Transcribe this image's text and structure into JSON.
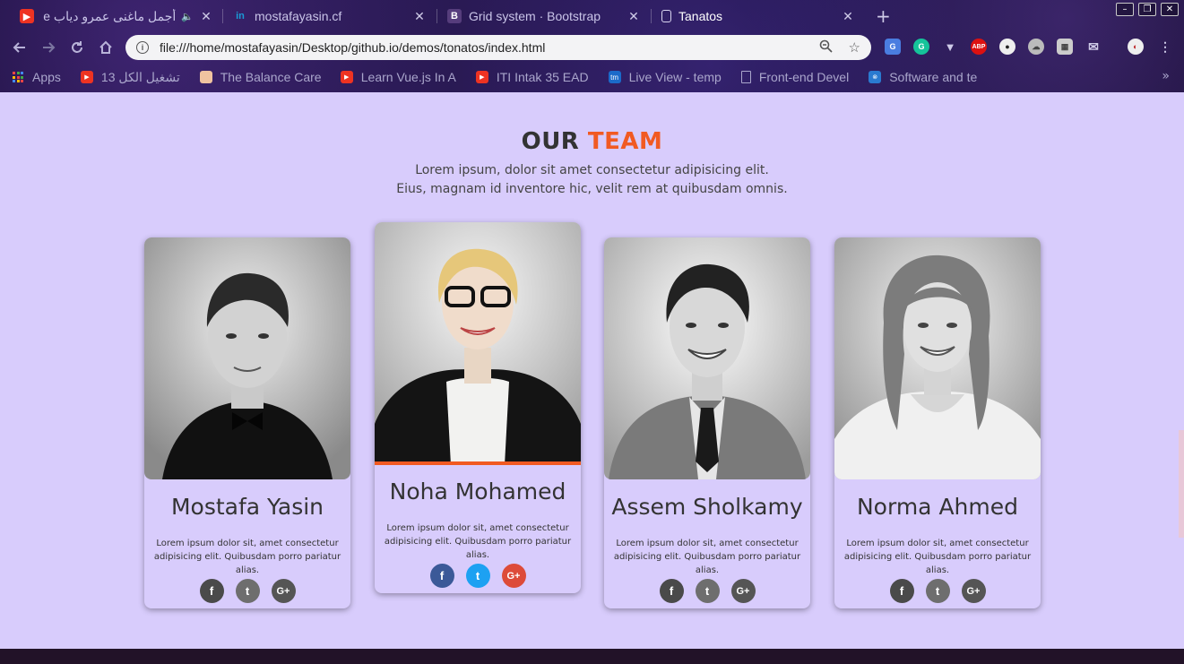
{
  "browser": {
    "tabs": [
      {
        "title": "أجمل ماغنى عمرو دياب e",
        "icon": "youtube-icon",
        "active": false,
        "audio": true
      },
      {
        "title": "mostafayasin.cf",
        "icon": "site-icon",
        "active": false
      },
      {
        "title": "Grid system · Bootstrap",
        "icon": "bootstrap-icon",
        "active": false
      },
      {
        "title": "Tanatos",
        "icon": "document-icon",
        "active": true
      }
    ],
    "new_tab_symbol": "+",
    "window_controls": {
      "minimize": "–",
      "restore": "❐",
      "close": "✕"
    },
    "url": "file:///home/mostafayasin/Desktop/github.io/demos/tonatos/index.html",
    "info_symbol": "i",
    "extensions": [
      "translate-icon",
      "grammarly-icon",
      "vue-devtools-icon",
      "adblock-icon",
      "extension-icon",
      "cloud-icon",
      "photo-icon",
      "mail-icon",
      "profile-icon"
    ],
    "adblock_label": "ABP",
    "bookmarks": [
      {
        "label": "Apps",
        "icon": "apps-grid-icon"
      },
      {
        "label": "13 تشغيل الكل",
        "icon": "youtube-icon"
      },
      {
        "label": "The Balance Care",
        "icon": "site-icon"
      },
      {
        "label": "Learn Vue.js In A",
        "icon": "youtube-icon"
      },
      {
        "label": "ITI Intak 35 EAD",
        "icon": "youtube-icon"
      },
      {
        "label": "Live View - temp",
        "icon": "tm-icon"
      },
      {
        "label": "Front-end Devel",
        "icon": "document-icon"
      },
      {
        "label": "Software and te",
        "icon": "site-icon"
      }
    ],
    "tm_label": "tm",
    "more_symbol": "»"
  },
  "section": {
    "title_main": "OUR ",
    "title_accent": "TEAM",
    "subtitle_line1": "Lorem ipsum, dolor sit amet consectetur adipisicing elit.",
    "subtitle_line2": "Eius, magnam id inventore hic, velit rem at quibusdam omnis."
  },
  "team": [
    {
      "name": "Mostafa Yasin",
      "desc": "Lorem ipsum dolor sit, amet consectetur adipisicing elit. Quibusdam porro pariatur alias."
    },
    {
      "name": "Noha Mohamed",
      "desc": "Lorem ipsum dolor sit, amet consectetur adipisicing elit. Quibusdam porro pariatur alias."
    },
    {
      "name": "Assem Sholkamy",
      "desc": "Lorem ipsum dolor sit, amet consectetur adipisicing elit. Quibusdam porro pariatur alias."
    },
    {
      "name": "Norma Ahmed",
      "desc": "Lorem ipsum dolor sit, amet consectetur adipisicing elit. Quibusdam porro pariatur alias."
    }
  ],
  "social": {
    "facebook": "f",
    "twitter": "t",
    "google": "G+"
  },
  "colors": {
    "accent": "#f15a22",
    "page_bg": "#d8ccfc",
    "facebook": "#3b5998",
    "twitter": "#1da1f2",
    "google": "#dd4b39"
  }
}
